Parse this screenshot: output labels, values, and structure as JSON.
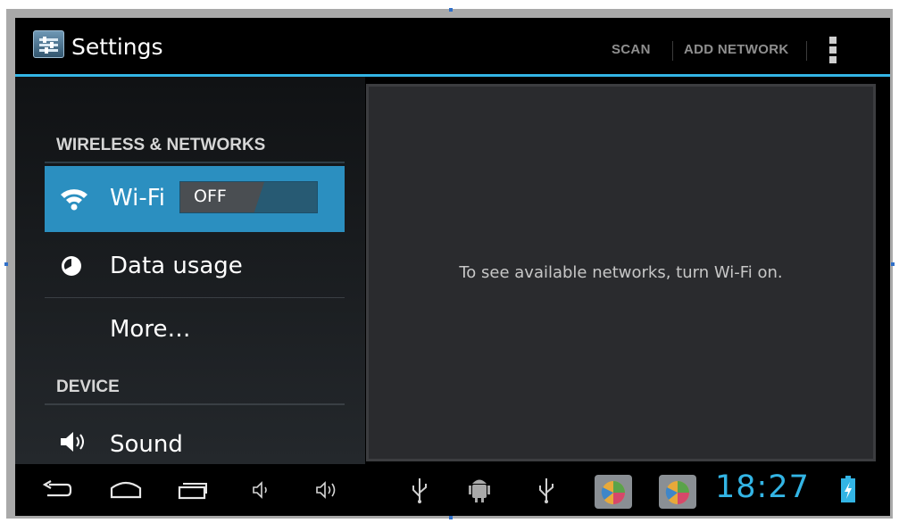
{
  "app": {
    "title": "Settings",
    "icon": "settings-app-icon"
  },
  "action_bar": {
    "scan_label": "SCAN",
    "add_network_label": "ADD NETWORK",
    "overflow_icon": "overflow-menu-icon"
  },
  "sidebar": {
    "categories": [
      {
        "label": "WIRELESS & NETWORKS",
        "items": [
          {
            "label": "Wi-Fi",
            "icon": "wifi-icon",
            "selected": true,
            "toggle": {
              "state": "OFF"
            }
          },
          {
            "label": "Data usage",
            "icon": "data-usage-icon"
          },
          {
            "label": "More…",
            "icon": ""
          }
        ]
      },
      {
        "label": "DEVICE",
        "items": [
          {
            "label": "Sound",
            "icon": "speaker-icon"
          }
        ]
      }
    ]
  },
  "main": {
    "empty_message": "To see available networks, turn Wi-Fi on."
  },
  "navbar": {
    "buttons": [
      "back-icon",
      "home-icon",
      "recent-apps-icon",
      "volume-down-icon",
      "volume-up-icon"
    ],
    "notifications": [
      "usb-icon",
      "android-debug-icon",
      "usb-icon",
      "app-store-icon",
      "app-store-icon"
    ],
    "time": "18:27",
    "battery_icon": "battery-charging-icon"
  },
  "colors": {
    "accent": "#33b5e5",
    "selected_row": "#2b8fc0",
    "background": "#000000"
  }
}
